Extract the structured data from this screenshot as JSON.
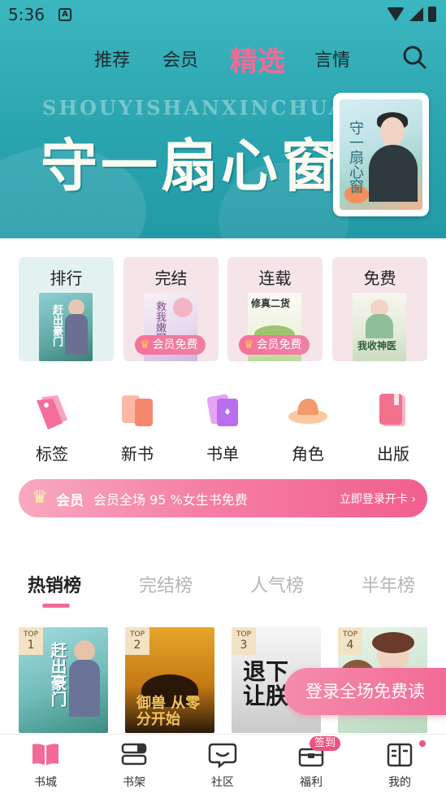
{
  "status_bar": {
    "time": "5:36",
    "app_badge": "A"
  },
  "top_nav": {
    "tabs": [
      {
        "label": "推荐",
        "active": false
      },
      {
        "label": "会员",
        "active": false
      },
      {
        "label": "精选",
        "active": true
      },
      {
        "label": "言情",
        "active": false
      }
    ],
    "search_icon": "search-icon"
  },
  "banner": {
    "pinyin": "SHOUYISHANXINCHUANG",
    "title": "守一扇心窗",
    "book_cover_title": "守一扇心窗"
  },
  "categories": [
    {
      "label": "排行",
      "badge": ""
    },
    {
      "label": "完结",
      "badge": "会员免费"
    },
    {
      "label": "连载",
      "badge": "会员免费"
    },
    {
      "label": "免费",
      "badge": ""
    }
  ],
  "category_covers": {
    "c1": "赶出豪门",
    "c2": "救我嫩野",
    "c3": "修真二货",
    "c4": "我收神医"
  },
  "quick_links": [
    {
      "label": "标签",
      "icon": "tag-icon"
    },
    {
      "label": "新书",
      "icon": "new-book-icon"
    },
    {
      "label": "书单",
      "icon": "book-list-icon"
    },
    {
      "label": "角色",
      "icon": "character-hat-icon"
    },
    {
      "label": "出版",
      "icon": "publish-icon"
    }
  ],
  "vip_banner": {
    "label": "会员",
    "text": "会员全场 95 %女生书免费",
    "cta": "立即登录开卡 ›"
  },
  "rank_tabs": [
    {
      "label": "热销榜",
      "active": true
    },
    {
      "label": "完结榜",
      "active": false
    },
    {
      "label": "人气榜",
      "active": false
    },
    {
      "label": "半年榜",
      "active": false
    }
  ],
  "top_books": [
    {
      "rank_label": "TOP",
      "rank": "1",
      "cover_text": "赶出豪门"
    },
    {
      "rank_label": "TOP",
      "rank": "2",
      "cover_text": "御兽 从零分开始"
    },
    {
      "rank_label": "TOP",
      "rank": "3",
      "cover_text": "退下 让朕来"
    },
    {
      "rank_label": "TOP",
      "rank": "4",
      "cover_text": ""
    }
  ],
  "floating_cta": "登录全场免费读",
  "bottom_nav": [
    {
      "label": "书城",
      "icon": "bookstore-icon",
      "active": true
    },
    {
      "label": "书架",
      "icon": "bookshelf-icon",
      "active": false
    },
    {
      "label": "社区",
      "icon": "community-icon",
      "active": false
    },
    {
      "label": "福利",
      "icon": "gift-icon",
      "active": false,
      "badge": "签到"
    },
    {
      "label": "我的",
      "icon": "profile-icon",
      "active": false
    }
  ],
  "colors": {
    "accent": "#f26b97",
    "hero": "#2aa5b0"
  }
}
